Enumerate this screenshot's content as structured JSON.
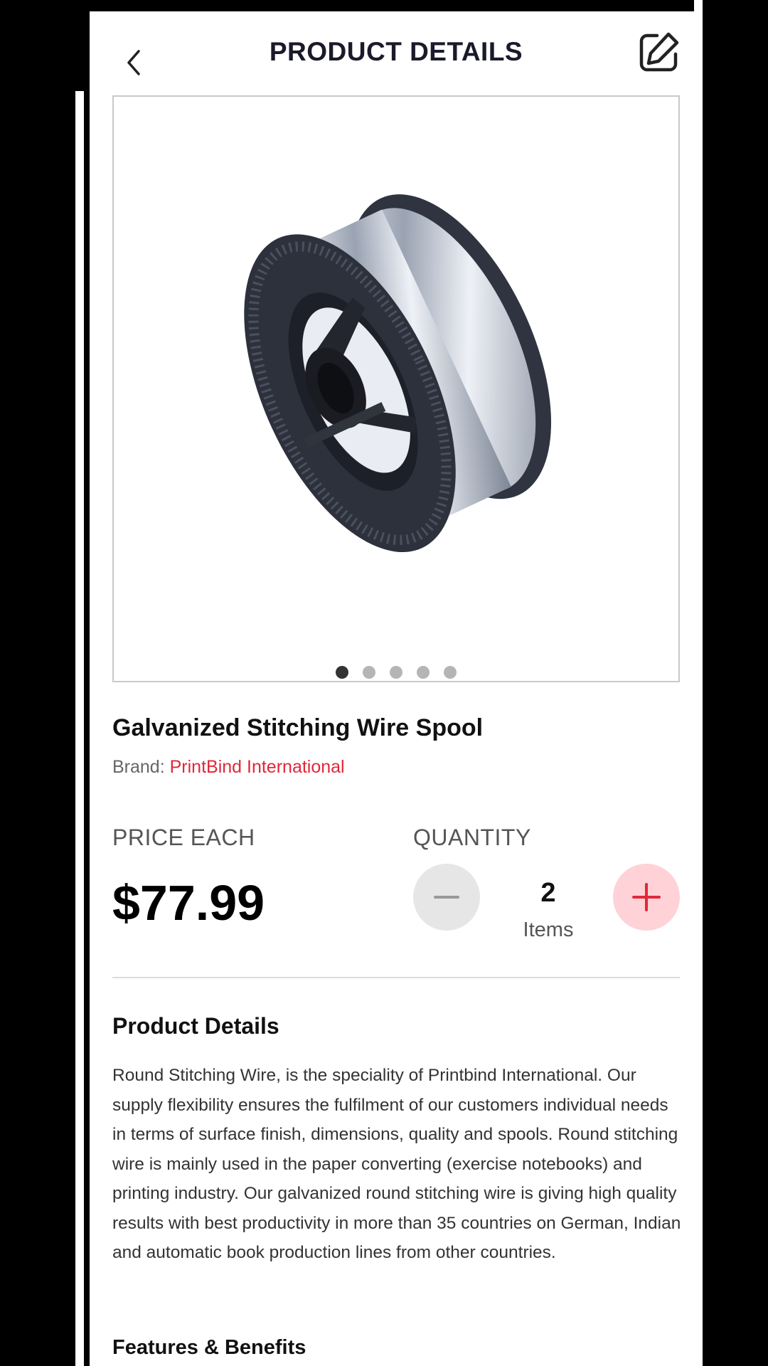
{
  "header": {
    "title": "PRODUCT DETAILS",
    "back_icon": "chevron-left-icon",
    "edit_icon": "edit-icon"
  },
  "gallery": {
    "image_subject": "wire spool",
    "dot_count": 5,
    "active_index": 0
  },
  "product": {
    "name": "Galvanized Stitching Wire Spool",
    "brand_label": "Brand:",
    "brand_name": "PrintBind International"
  },
  "pricing": {
    "price_label": "PRICE EACH",
    "price": "$77.99",
    "quantity_label": "QUANTITY",
    "quantity_value": "2",
    "quantity_unit": "Items",
    "minus_icon": "minus-icon",
    "plus_icon": "plus-icon"
  },
  "details": {
    "title": "Product Details",
    "description": "Round Stitching Wire, is the speciality of Printbind International. Our supply flexibility ensures the fulfilment of our customers individual needs in terms of surface finish, dimensions, quality and spools. Round stitching wire is mainly used in the paper converting (exercise notebooks) and printing industry. Our galvanized round stitching wire is giving high quality results with best productivity in more than 35 countries on German, Indian and automatic book production lines from other countries.",
    "features_title": "Features & Benefits"
  },
  "colors": {
    "accent": "#e0283a",
    "plus_bg": "#ffd2d7",
    "minus_bg": "#e6e6e6"
  }
}
